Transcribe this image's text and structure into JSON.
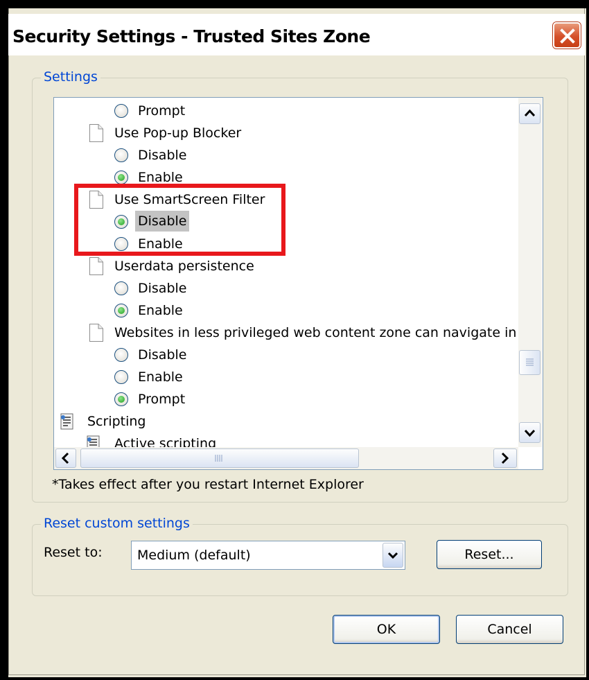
{
  "window": {
    "title": "Security Settings - Trusted Sites Zone"
  },
  "settings_group": {
    "label": "Settings",
    "rows": [
      {
        "kind": "radio",
        "label": "Prompt",
        "checked": false
      },
      {
        "kind": "item",
        "label": "Use Pop-up Blocker"
      },
      {
        "kind": "radio",
        "label": "Disable",
        "checked": false
      },
      {
        "kind": "radio",
        "label": "Enable",
        "checked": true
      },
      {
        "kind": "item",
        "label": "Use SmartScreen Filter"
      },
      {
        "kind": "radio",
        "label": "Disable",
        "checked": true,
        "selected": true
      },
      {
        "kind": "radio",
        "label": "Enable",
        "checked": false
      },
      {
        "kind": "item",
        "label": "Userdata persistence"
      },
      {
        "kind": "radio",
        "label": "Disable",
        "checked": false
      },
      {
        "kind": "radio",
        "label": "Enable",
        "checked": true
      },
      {
        "kind": "item",
        "label": "Websites in less privileged web content zone can navigate in"
      },
      {
        "kind": "radio",
        "label": "Disable",
        "checked": false
      },
      {
        "kind": "radio",
        "label": "Enable",
        "checked": false
      },
      {
        "kind": "radio",
        "label": "Prompt",
        "checked": true
      },
      {
        "kind": "category",
        "label": "Scripting"
      },
      {
        "kind": "subcategory",
        "label": "Active scripting"
      }
    ],
    "note": "*Takes effect after you restart Internet Explorer"
  },
  "reset_group": {
    "label": "Reset custom settings",
    "reset_to_label": "Reset to:",
    "reset_to_value": "Medium (default)",
    "reset_button": "Reset..."
  },
  "buttons": {
    "ok": "OK",
    "cancel": "Cancel"
  },
  "colors": {
    "group_label": "#0046d5",
    "highlight_box": "#e8181c",
    "dialog_face": "#ece9d8"
  }
}
